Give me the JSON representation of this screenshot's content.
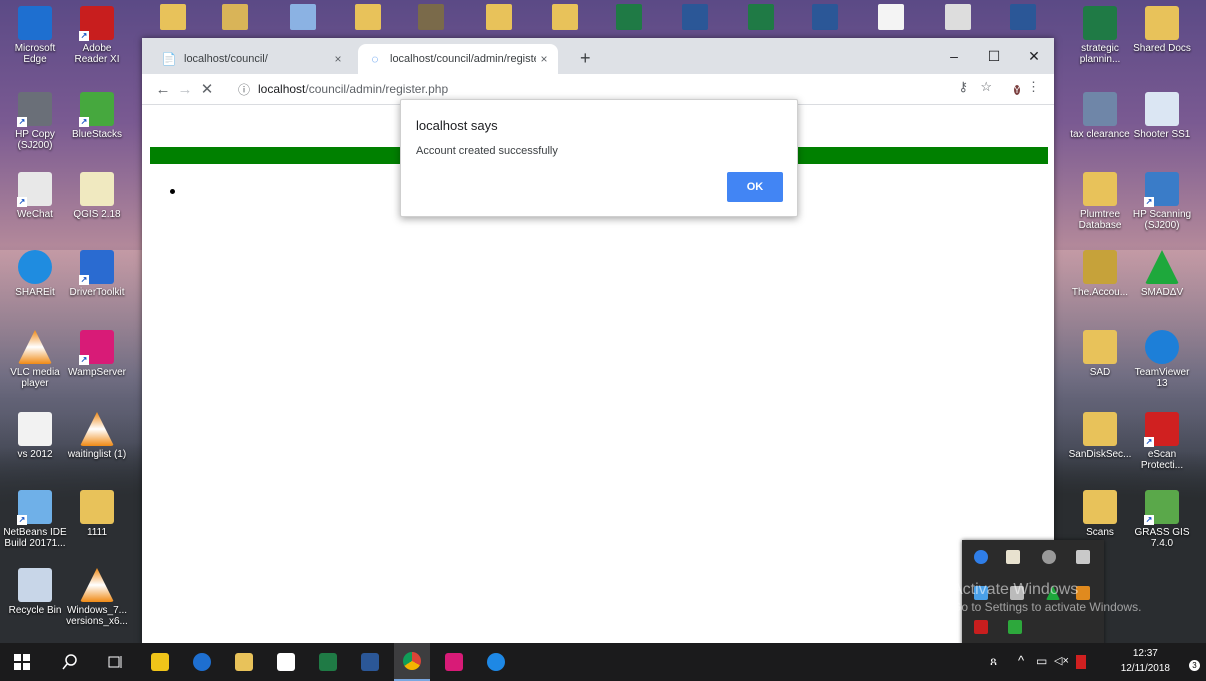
{
  "desktop": {
    "left_icons": [
      {
        "name": "microsoft-edge-icon",
        "label": "Microsoft Edge",
        "color": "#1e6fd0"
      },
      {
        "name": "adobe-reader-icon",
        "label": "Adobe Reader XI",
        "color": "#c81e1e"
      },
      {
        "name": "hp-copy-icon",
        "label": "HP Copy (SJ200)",
        "color": "#6a6f78"
      },
      {
        "name": "bluestacks-icon",
        "label": "BlueStacks",
        "color": "#46a83e"
      },
      {
        "name": "wechat-icon",
        "label": "WeChat",
        "color": "#e8e8e8"
      },
      {
        "name": "qgis-icon",
        "label": "QGIS 2.18",
        "color": "#f0e9c0"
      },
      {
        "name": "shareit-icon",
        "label": "SHAREit",
        "color": "#1f8ce0"
      },
      {
        "name": "drivertoolkit-icon",
        "label": "DriverToolkit",
        "color": "#2a6bd1"
      },
      {
        "name": "vlc-icon",
        "label": "VLC media player",
        "color": "#f08a15"
      },
      {
        "name": "wampserver-icon",
        "label": "WampServer",
        "color": "#d81b77"
      },
      {
        "name": "text-file-icon",
        "label": "vs 2012",
        "color": "#f2f2f2"
      },
      {
        "name": "vlc-file-icon",
        "label": "waitinglist (1)",
        "color": "#f08a15"
      },
      {
        "name": "netbeans-icon",
        "label": "NetBeans IDE Build 20171...",
        "color": "#6fb0e8"
      },
      {
        "name": "folder-icon",
        "label": "1111",
        "color": "#e8c25a"
      },
      {
        "name": "recycle-bin-icon",
        "label": "Recycle Bin",
        "color": "#c8d6e8"
      },
      {
        "name": "vlc-file-icon",
        "label": "Windows_7... versions_x6...",
        "color": "#f08a15"
      }
    ],
    "right_icons": [
      {
        "name": "excel-file-icon",
        "label": "strategic plannin...",
        "color": "#1f7a45"
      },
      {
        "name": "folder-icon",
        "label": "Shared Docs",
        "color": "#e8c25a"
      },
      {
        "name": "tax-clearance-icon",
        "label": "tax clearance",
        "color": "#6f86a8"
      },
      {
        "name": "shooter-icon",
        "label": "Shooter SS1",
        "color": "#dbe6f3"
      },
      {
        "name": "folder-icon",
        "label": "Plumtree Database",
        "color": "#e8c25a"
      },
      {
        "name": "hp-scanning-icon",
        "label": "HP Scanning (SJ200)",
        "color": "#3a7cc8"
      },
      {
        "name": "accounting-icon",
        "label": "The.Accou...",
        "color": "#c6a23a"
      },
      {
        "name": "smadav-icon",
        "label": "SMADΔV",
        "color": "#1ea83c"
      },
      {
        "name": "zip-file-icon",
        "label": "SAD",
        "color": "#e8c25a"
      },
      {
        "name": "teamviewer-icon",
        "label": "TeamViewer 13",
        "color": "#1d7fd8"
      },
      {
        "name": "sandisk-icon",
        "label": "SanDiskSec...",
        "color": "#e8c25a"
      },
      {
        "name": "escan-icon",
        "label": "eScan Protecti...",
        "color": "#d02020"
      },
      {
        "name": "folder-icon",
        "label": "Scans",
        "color": "#e8c25a"
      },
      {
        "name": "grass-gis-icon",
        "label": "GRASS GIS 7.4.0",
        "color": "#5aa84a"
      }
    ]
  },
  "browser": {
    "tabs": [
      {
        "title": "localhost/council/",
        "close": "×",
        "icon": "📄"
      },
      {
        "title": "localhost/council/admin/register",
        "close": "×",
        "icon": "◌"
      }
    ],
    "new_tab": "+",
    "window_controls": {
      "minimize": "–",
      "maximize": "☐",
      "close": "✕"
    },
    "nav": {
      "back": "←",
      "forward": "→",
      "stop": "✕"
    },
    "address": {
      "info_icon": "ⓘ",
      "host": "localhost",
      "path": "/council/admin/register.php"
    },
    "toolbar_right": {
      "key": "⚷",
      "star": "☆",
      "avatar": "Y",
      "menu": "⋮"
    },
    "page": {
      "green_color": "#008000"
    }
  },
  "dialog": {
    "title": "localhost says",
    "message": "Account created successfully",
    "ok_label": "OK",
    "button_color": "#4285f4"
  },
  "watermark": {
    "line1": "Activate Windows",
    "line2": "Go to Settings to activate Windows."
  },
  "taskbar": {
    "apps": [
      "windows-start",
      "search",
      "task-view",
      "store",
      "edge",
      "file-explorer",
      "mail",
      "excel",
      "word",
      "chrome",
      "wampserver",
      "internet-explorer"
    ],
    "clock_time": "12:37",
    "clock_date": "12/11/2018",
    "notification_count": "3",
    "tray_symbols": {
      "people": "ጸ",
      "up": "^",
      "network": "▭",
      "volume": "◁×"
    }
  }
}
